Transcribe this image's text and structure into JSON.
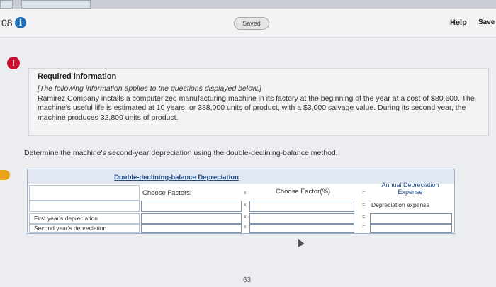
{
  "browser": {
    "tab_1": "",
    "tab_2": ""
  },
  "header": {
    "question_number": "08",
    "saved_label": "Saved",
    "help_label": "Help",
    "save_label": "Save"
  },
  "required_info": {
    "title": "Required information",
    "intro": "[The following information applies to the questions displayed below.]",
    "body": "Ramirez Company installs a computerized manufacturing machine in its factory at the beginning of the year at a cost of $80,600. The machine's useful life is estimated at 10 years, or 388,000 units of product, with a $3,000 salvage value. During its second year, the machine produces 32,800 units of product."
  },
  "instruction": "Determine the machine's second-year depreciation using the double-declining-balance method.",
  "table": {
    "title": "Double-declining-balance Depreciation",
    "col_choose_factors": "Choose Factors:",
    "col_choose_factor_pct": "Choose Factor(%)",
    "col_annual_line1": "Annual Depreciation",
    "col_annual_line2": "Expense",
    "depreciation_expense": "Depreciation expense",
    "op_multiply": "x",
    "op_equals": "=",
    "rows": [
      {
        "label": ""
      },
      {
        "label": "First year's depreciation"
      },
      {
        "label": "Second year's depreciation"
      }
    ]
  },
  "footer": {
    "page_number": "63"
  }
}
